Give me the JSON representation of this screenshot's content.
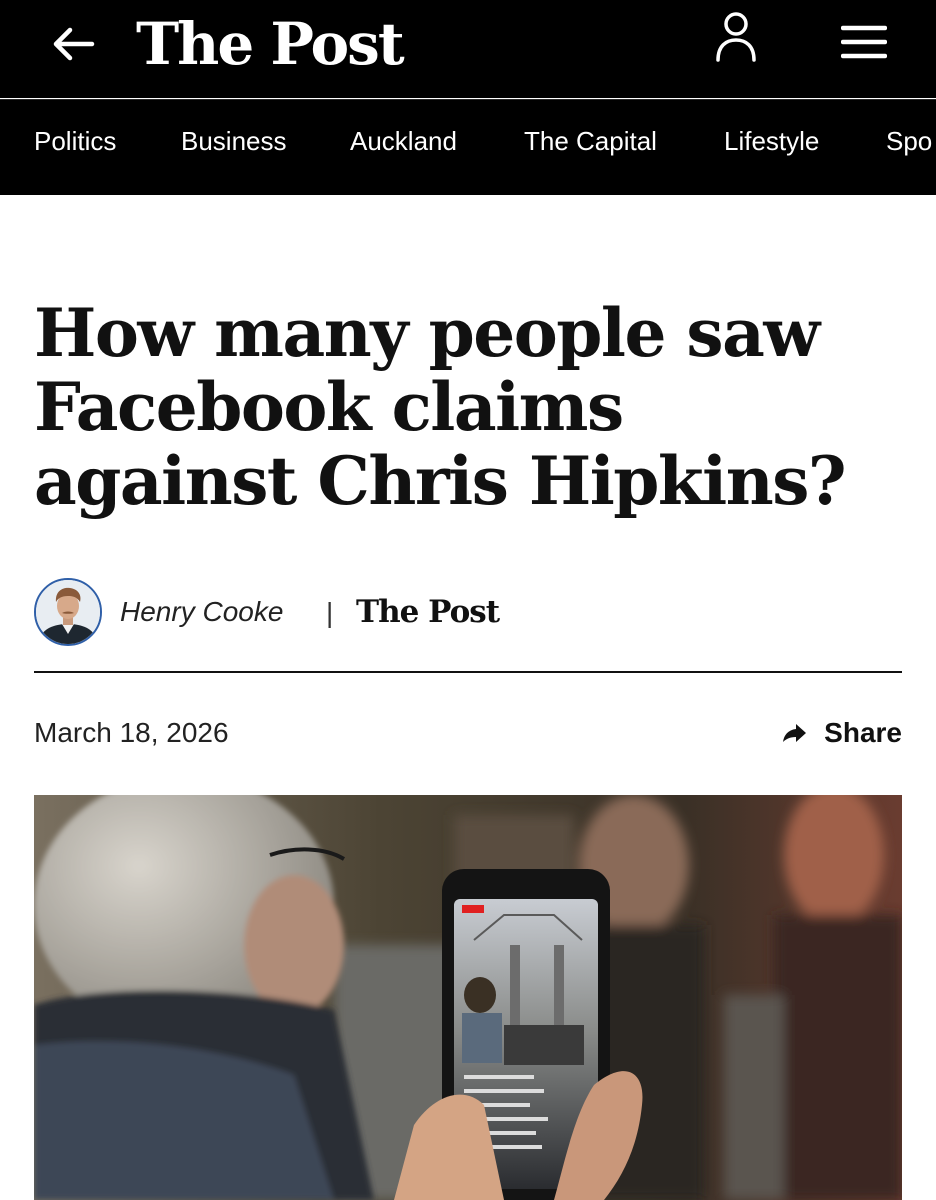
{
  "header": {
    "logo": "The Post",
    "back_icon": "arrow-left-icon",
    "user_icon": "user-icon",
    "menu_icon": "hamburger-menu-icon"
  },
  "nav": {
    "items": [
      "Politics",
      "Business",
      "Auckland",
      "The Capital",
      "Lifestyle",
      "Spo"
    ]
  },
  "article": {
    "headline": "How many people saw Facebook claims against Chris Hipkins?",
    "author": "Henry Cooke",
    "separator": "|",
    "publication": "The Post",
    "date": "March 18, 2026",
    "share_label": "Share",
    "share_icon": "share-arrow-icon"
  },
  "colors": {
    "header_bg": "#000000",
    "text": "#111111",
    "avatar_border": "#2f5fa8"
  }
}
